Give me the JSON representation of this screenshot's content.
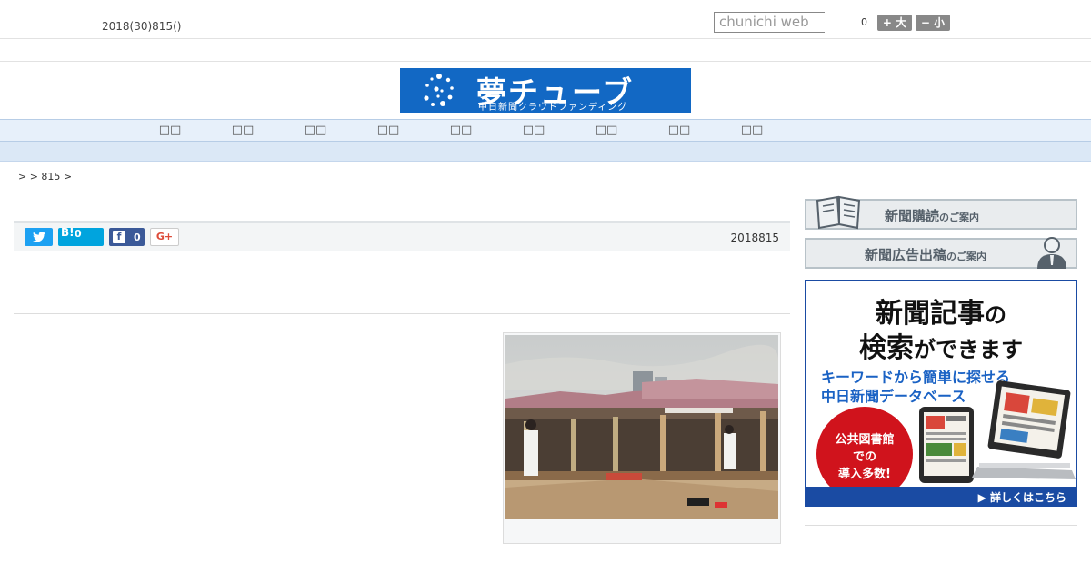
{
  "header": {
    "date": "2018(30)815()",
    "search_placeholder": "chunichi web",
    "count": "0",
    "font_large_label": "+ 大",
    "font_small_label": "− 小"
  },
  "logo": {
    "main": "夢チューブ",
    "sub": "中日新聞クラウドファンディング",
    "bg_color": "#1268c4"
  },
  "nav": {
    "items": [
      "□□",
      "□□",
      "□□",
      "□□",
      "□□",
      "□□",
      "□□",
      "□□",
      "□□"
    ]
  },
  "breadcrumb": ">  > 815 >",
  "share": {
    "twitter_icon": "twitter-bird-icon",
    "hatena_label": "B!",
    "hatena_count": "0",
    "facebook_label": "f",
    "facebook_count": "0",
    "googleplus_label": "G+",
    "date": "2018815"
  },
  "sidebar": {
    "subscribe_title": "新聞購読",
    "subscribe_suffix": "のご案内",
    "ad_title": "新聞広告出稿",
    "ad_suffix": "のご案内",
    "banner": {
      "headline_1": "新聞記事",
      "headline_1_suffix": "の",
      "headline_2": "検索",
      "headline_2_suffix": "ができます",
      "sub_1": "キーワードから簡単に探せる",
      "sub_2": "中日新聞データベース",
      "circle_1": "公共図書館",
      "circle_2": "での",
      "circle_3": "導入多数!",
      "footer": "▶ 詳しくはこちら"
    }
  }
}
